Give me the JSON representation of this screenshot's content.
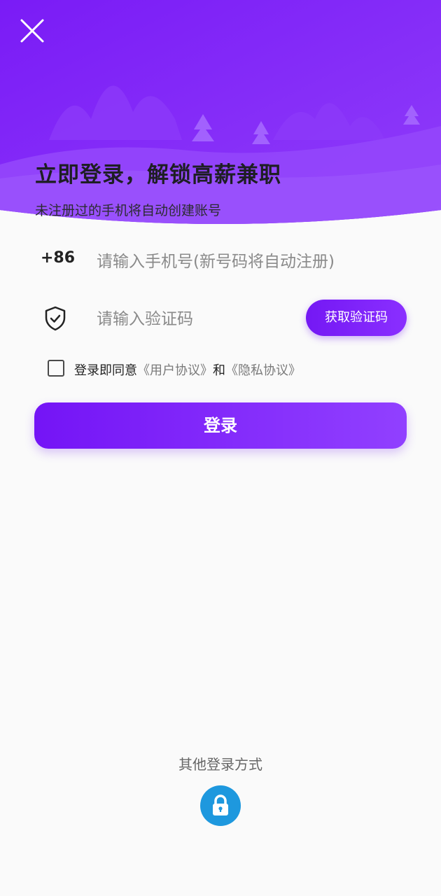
{
  "header": {
    "headline": "立即登录，解锁高薪兼职",
    "subline": "未注册过的手机将自动创建账号",
    "gradient_colors": [
      "#7a1bf6",
      "#8f3dfa"
    ]
  },
  "close": {
    "icon": "close-icon"
  },
  "phone": {
    "country_code": "+86",
    "value": "",
    "placeholder": "请输入手机号(新号码将自动注册)"
  },
  "code": {
    "icon": "shield-check-icon",
    "value": "",
    "placeholder": "请输入验证码",
    "send_label": "获取验证码"
  },
  "agreement": {
    "checked": false,
    "prefix": "登录即同意",
    "user_agreement": "《用户协议》",
    "joiner": "和",
    "privacy_policy": "《隐私协议》"
  },
  "login": {
    "label": "登录",
    "accent": "#7a1bf6"
  },
  "other": {
    "label": "其他登录方式",
    "methods": [
      {
        "icon": "lock-icon",
        "color": "#1e98de"
      }
    ]
  }
}
